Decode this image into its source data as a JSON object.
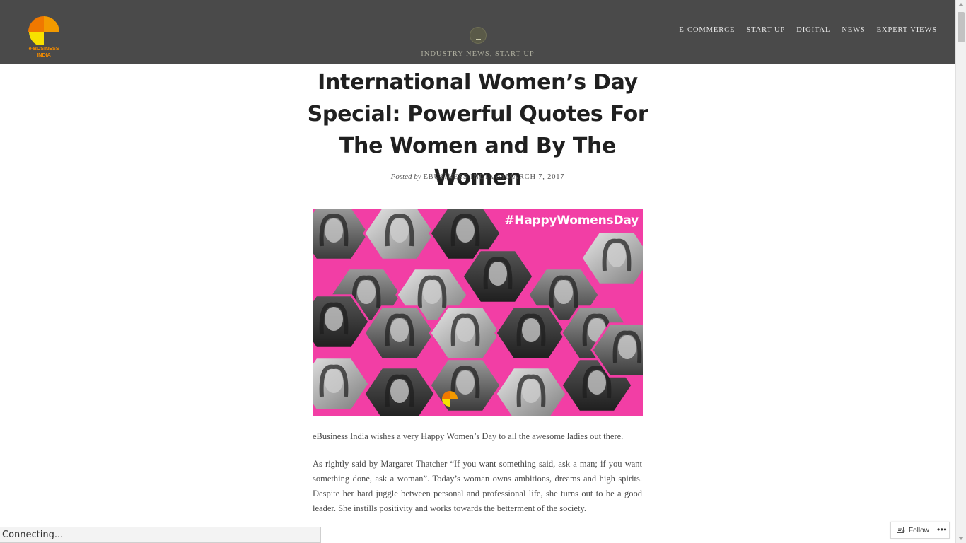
{
  "site": {
    "logo_text": "e-BUSINESS INDIA",
    "brand_colors": {
      "orange": "#f28c00",
      "yellow": "#f7e100",
      "header_bg": "#4a4a4a",
      "hero_pink": "#f23ea5"
    }
  },
  "nav": {
    "items": [
      "E-COMMERCE",
      "START-UP",
      "DIGITAL",
      "NEWS",
      "EXPERT VIEWS"
    ]
  },
  "meta": {
    "icon": "list-icon",
    "categories": [
      "INDUSTRY NEWS",
      "START-UP"
    ],
    "separator": ", "
  },
  "article": {
    "title": "International Women’s Day Special: Powerful Quotes For The Women and By The Women",
    "posted_by_label": "Posted by",
    "author": "EBUSINESS INDIA",
    "on_label": "on",
    "date": "MARCH 7, 2017",
    "hero_hashtag": "#HappyWomensDay",
    "paragraphs": [
      "eBusiness India wishes a very Happy Women’s Day to all the awesome ladies out there.",
      "As rightly said by Margaret Thatcher “If you want something said, ask a man; if you want something done, ask a woman”.  Today’s woman owns ambitions, dreams and high spirits. Despite her hard juggle between personal and professional life, she turns out to be a good leader. She instills positivity and works towards the betterment of the society."
    ]
  },
  "status_bar": {
    "text": "Connecting..."
  },
  "follow_widget": {
    "label": "Follow",
    "more": "•••"
  }
}
